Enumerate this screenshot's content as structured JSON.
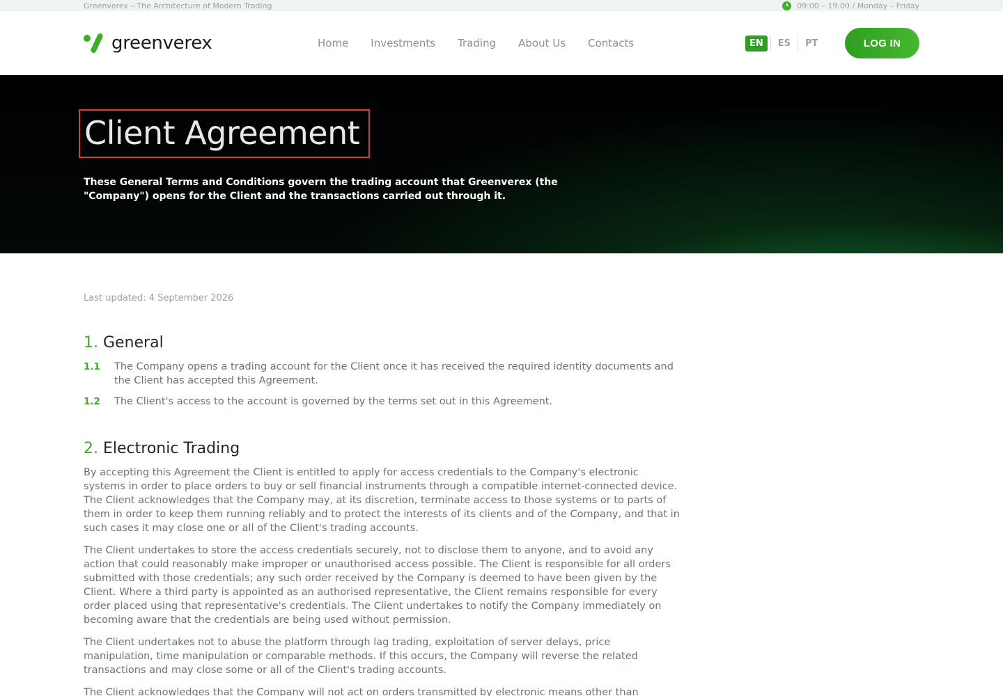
{
  "topbar": {
    "tagline": "Greenverex – The Architecture of Modern Trading",
    "hours": "09:00 – 19:00 / Monday – Friday"
  },
  "header": {
    "logo_text": "greenverex",
    "nav": [
      "Home",
      "Investments",
      "Trading",
      "About Us",
      "Contacts"
    ],
    "languages": [
      "EN",
      "ES",
      "PT"
    ],
    "active_language": "EN",
    "login_label": "LOG IN"
  },
  "hero": {
    "title": "Client Agreement",
    "subtitle": "These General Terms and Conditions govern the trading account that Greenverex (the \"Company\") opens for the Client and the transactions carried out through it."
  },
  "content": {
    "updated": "Last updated: 4 September 2026",
    "sections": [
      {
        "num": "1.",
        "title": "General",
        "clauses": [
          {
            "num": "1.1",
            "text": "The Company opens a trading account for the Client once it has received the required identity documents and the Client has accepted this Agreement."
          },
          {
            "num": "1.2",
            "text": "The Client's access to the account is governed by the terms set out in this Agreement."
          }
        ]
      },
      {
        "num": "2.",
        "title": "Electronic Trading",
        "paragraphs": [
          "By accepting this Agreement the Client is entitled to apply for access credentials to the Company's electronic systems in order to place orders to buy or sell financial instruments through a compatible internet-connected device. The Client acknowledges that the Company may, at its discretion, terminate access to those systems or to parts of them in order to keep them running reliably and to protect the interests of its clients and of the Company, and that in such cases it may close one or all of the Client's trading accounts.",
          "The Client undertakes to store the access credentials securely, not to disclose them to anyone, and to avoid any action that could reasonably make improper or unauthorised access possible. The Client is responsible for all orders submitted with those credentials; any such order received by the Company is deemed to have been given by the Client. Where a third party is appointed as an authorised representative, the Client remains responsible for every order placed using that representative's credentials. The Client undertakes to notify the Company immediately on becoming aware that the credentials are being used without permission.",
          "The Client undertakes not to abuse the platform through lag trading, exploitation of server delays, price manipulation, time manipulation or comparable methods. If this occurs, the Company will reverse the related transactions and may close some or all of the Client's trading accounts.",
          "The Client acknowledges that the Company will not act on orders transmitted by electronic means other than"
        ]
      }
    ]
  },
  "colors": {
    "accent": "#3fae29",
    "highlight_border": "#d93a3a"
  }
}
